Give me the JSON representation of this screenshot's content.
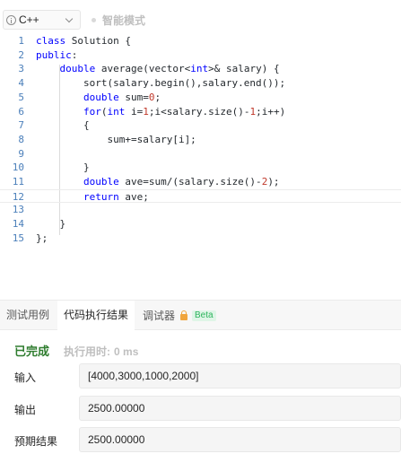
{
  "toolbar": {
    "language": "C++",
    "smart_mode": "智能模式"
  },
  "editor": {
    "line_numbers": [
      "1",
      "2",
      "3",
      "4",
      "5",
      "6",
      "7",
      "8",
      "9",
      "10",
      "11",
      "12",
      "13",
      "14",
      "15"
    ],
    "current_line": 12
  },
  "tabs": [
    {
      "label": "测试用例"
    },
    {
      "label": "代码执行结果"
    },
    {
      "label": "调试器"
    }
  ],
  "beta_badge": "Beta",
  "result": {
    "status": "已完成",
    "time_label": "执行用时:",
    "time_value": "0 ms",
    "input_label": "输入",
    "input_value": "[4000,3000,1000,2000]",
    "output_label": "输出",
    "output_value": "2500.00000",
    "expected_label": "预期结果",
    "expected_value": "2500.00000"
  },
  "colors": {
    "keyword": "#0000ff",
    "number": "#c0392b",
    "status_green": "#2f7d2f",
    "beta_green": "#2db55d"
  },
  "icons": [
    "info-icon",
    "chevron-down-icon",
    "lock-icon"
  ]
}
